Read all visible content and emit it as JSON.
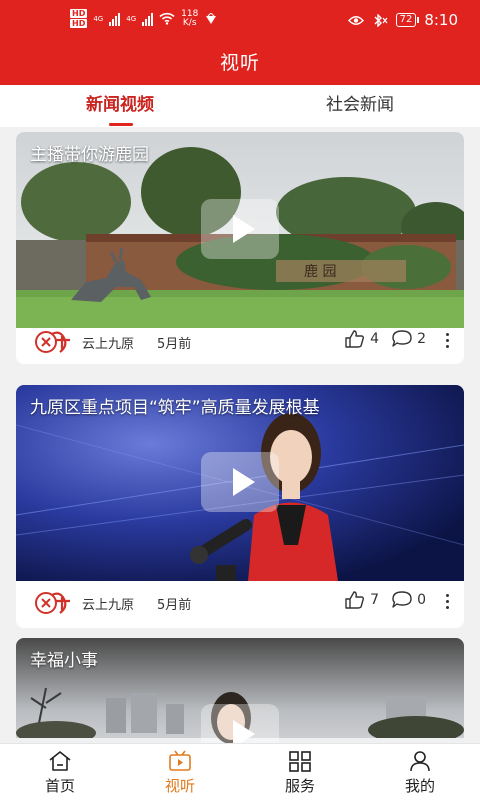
{
  "status_bar": {
    "hd_top": "HD",
    "hd_bottom": "HD",
    "net_1": "4G",
    "net_2": "4G",
    "speed_value": "118",
    "speed_unit": "K/s",
    "battery": "72",
    "time": "8:10",
    "icons": [
      "signal-icon",
      "wifi-icon",
      "eye-icon",
      "bluetooth-icon",
      "battery-icon"
    ]
  },
  "header": {
    "title": "视听",
    "color": "#e0231e"
  },
  "tabs": [
    {
      "label": "新闻视频",
      "active": true
    },
    {
      "label": "社会新闻",
      "active": false
    }
  ],
  "feed": [
    {
      "title": "主播带你游鹿园",
      "source": "云上九原",
      "time": "5月前",
      "likes": "4",
      "comments": "2",
      "sign_text": "鹿 园"
    },
    {
      "title": "九原区重点项目“筑牢”高质量发展根基",
      "source": "云上九原",
      "time": "5月前",
      "likes": "7",
      "comments": "0"
    },
    {
      "title": "幸福小事"
    }
  ],
  "bottom_nav": [
    {
      "label": "首页",
      "icon": "home-icon",
      "active": false
    },
    {
      "label": "视听",
      "icon": "video-icon",
      "active": true
    },
    {
      "label": "服务",
      "icon": "grid-icon",
      "active": false
    },
    {
      "label": "我的",
      "icon": "user-icon",
      "active": false
    }
  ],
  "colors": {
    "accent": "#e0231e",
    "active_nav": "#e07b1e",
    "active_tab": "#c9241f"
  }
}
